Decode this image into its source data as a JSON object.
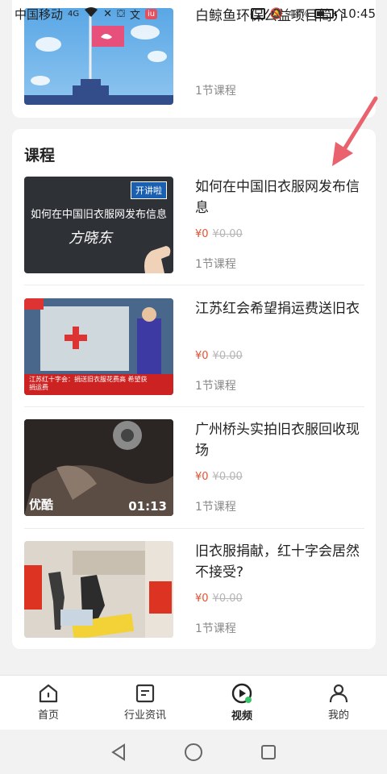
{
  "status_bar": {
    "carrier": "中国移动",
    "network": "4G",
    "battery": "44%",
    "time": "10:45"
  },
  "top_course": {
    "title": "白鲸鱼环保公益项目简介",
    "lessons": "1节课程"
  },
  "section": {
    "title": "课程"
  },
  "courses": [
    {
      "title": "如何在中国旧衣服网发布信息",
      "price_now": "¥0",
      "price_old": "¥0.00",
      "lessons": "1节课程",
      "thumb_caption": "如何在中国旧衣服网发布信息",
      "thumb_signature": "方晓东",
      "thumb_badge": "开讲啦"
    },
    {
      "title": "江苏红会希望捐运费送旧衣",
      "price_now": "¥0",
      "price_old": "¥0.00",
      "lessons": "1节课程",
      "thumb_caption": "江苏红十字会：捐送旧衣服花费高 希望获捐运费"
    },
    {
      "title": "广州桥头实拍旧衣服回收现场",
      "price_now": "¥0",
      "price_old": "¥0.00",
      "lessons": "1节课程",
      "thumb_logo": "优酷",
      "thumb_time": "01:13"
    },
    {
      "title": "旧衣服捐献，红十字会居然不接受?",
      "price_now": "¥0",
      "price_old": "¥0.00",
      "lessons": "1节课程"
    }
  ],
  "bottom_nav": [
    {
      "label": "首页",
      "icon": "home-icon"
    },
    {
      "label": "行业资讯",
      "icon": "news-icon"
    },
    {
      "label": "视频",
      "icon": "video-play-icon",
      "active": true
    },
    {
      "label": "我的",
      "icon": "profile-icon"
    }
  ],
  "colors": {
    "accent_price": "#e8502f",
    "annotation_arrow": "#e9626d"
  }
}
